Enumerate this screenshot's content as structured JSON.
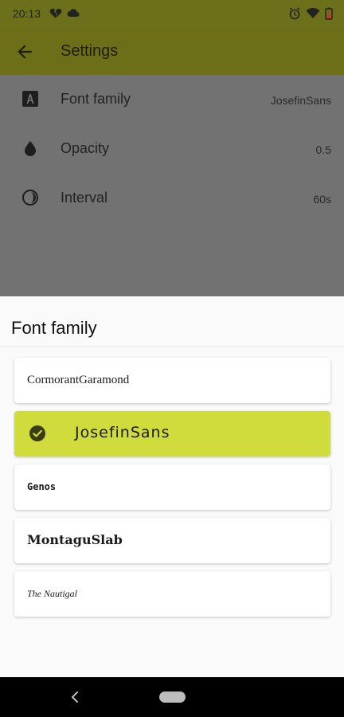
{
  "status_bar": {
    "time": "20:13",
    "left_icons": [
      "broken-heart-icon",
      "cloud-icon"
    ],
    "right_icons": [
      "alarm-icon",
      "wifi-icon",
      "battery-low-icon"
    ]
  },
  "app_bar": {
    "back_icon": "arrow-back-icon",
    "title": "Settings"
  },
  "settings": [
    {
      "icon": "font-icon",
      "label": "Font family",
      "value": "JosefinSans"
    },
    {
      "icon": "opacity-drop-icon",
      "label": "Opacity",
      "value": "0.5"
    },
    {
      "icon": "interval-half-circle-icon",
      "label": "Interval",
      "value": "60s"
    }
  ],
  "sheet": {
    "title": "Font family",
    "options": [
      {
        "label": "CormorantGaramond",
        "selected": false
      },
      {
        "label": "JosefinSans",
        "selected": true
      },
      {
        "label": "Genos",
        "selected": false
      },
      {
        "label": "MontaguSlab",
        "selected": false
      },
      {
        "label": "The Nautigal",
        "selected": false
      }
    ],
    "selected_color": "#cfdc3c"
  },
  "nav_bar": {
    "back_icon": "nav-back-icon",
    "home_icon": "nav-home-pill-icon"
  },
  "colors": {
    "app_bar": "#6c6f17",
    "status_bar": "#6d701a",
    "scrim": "#727272"
  }
}
